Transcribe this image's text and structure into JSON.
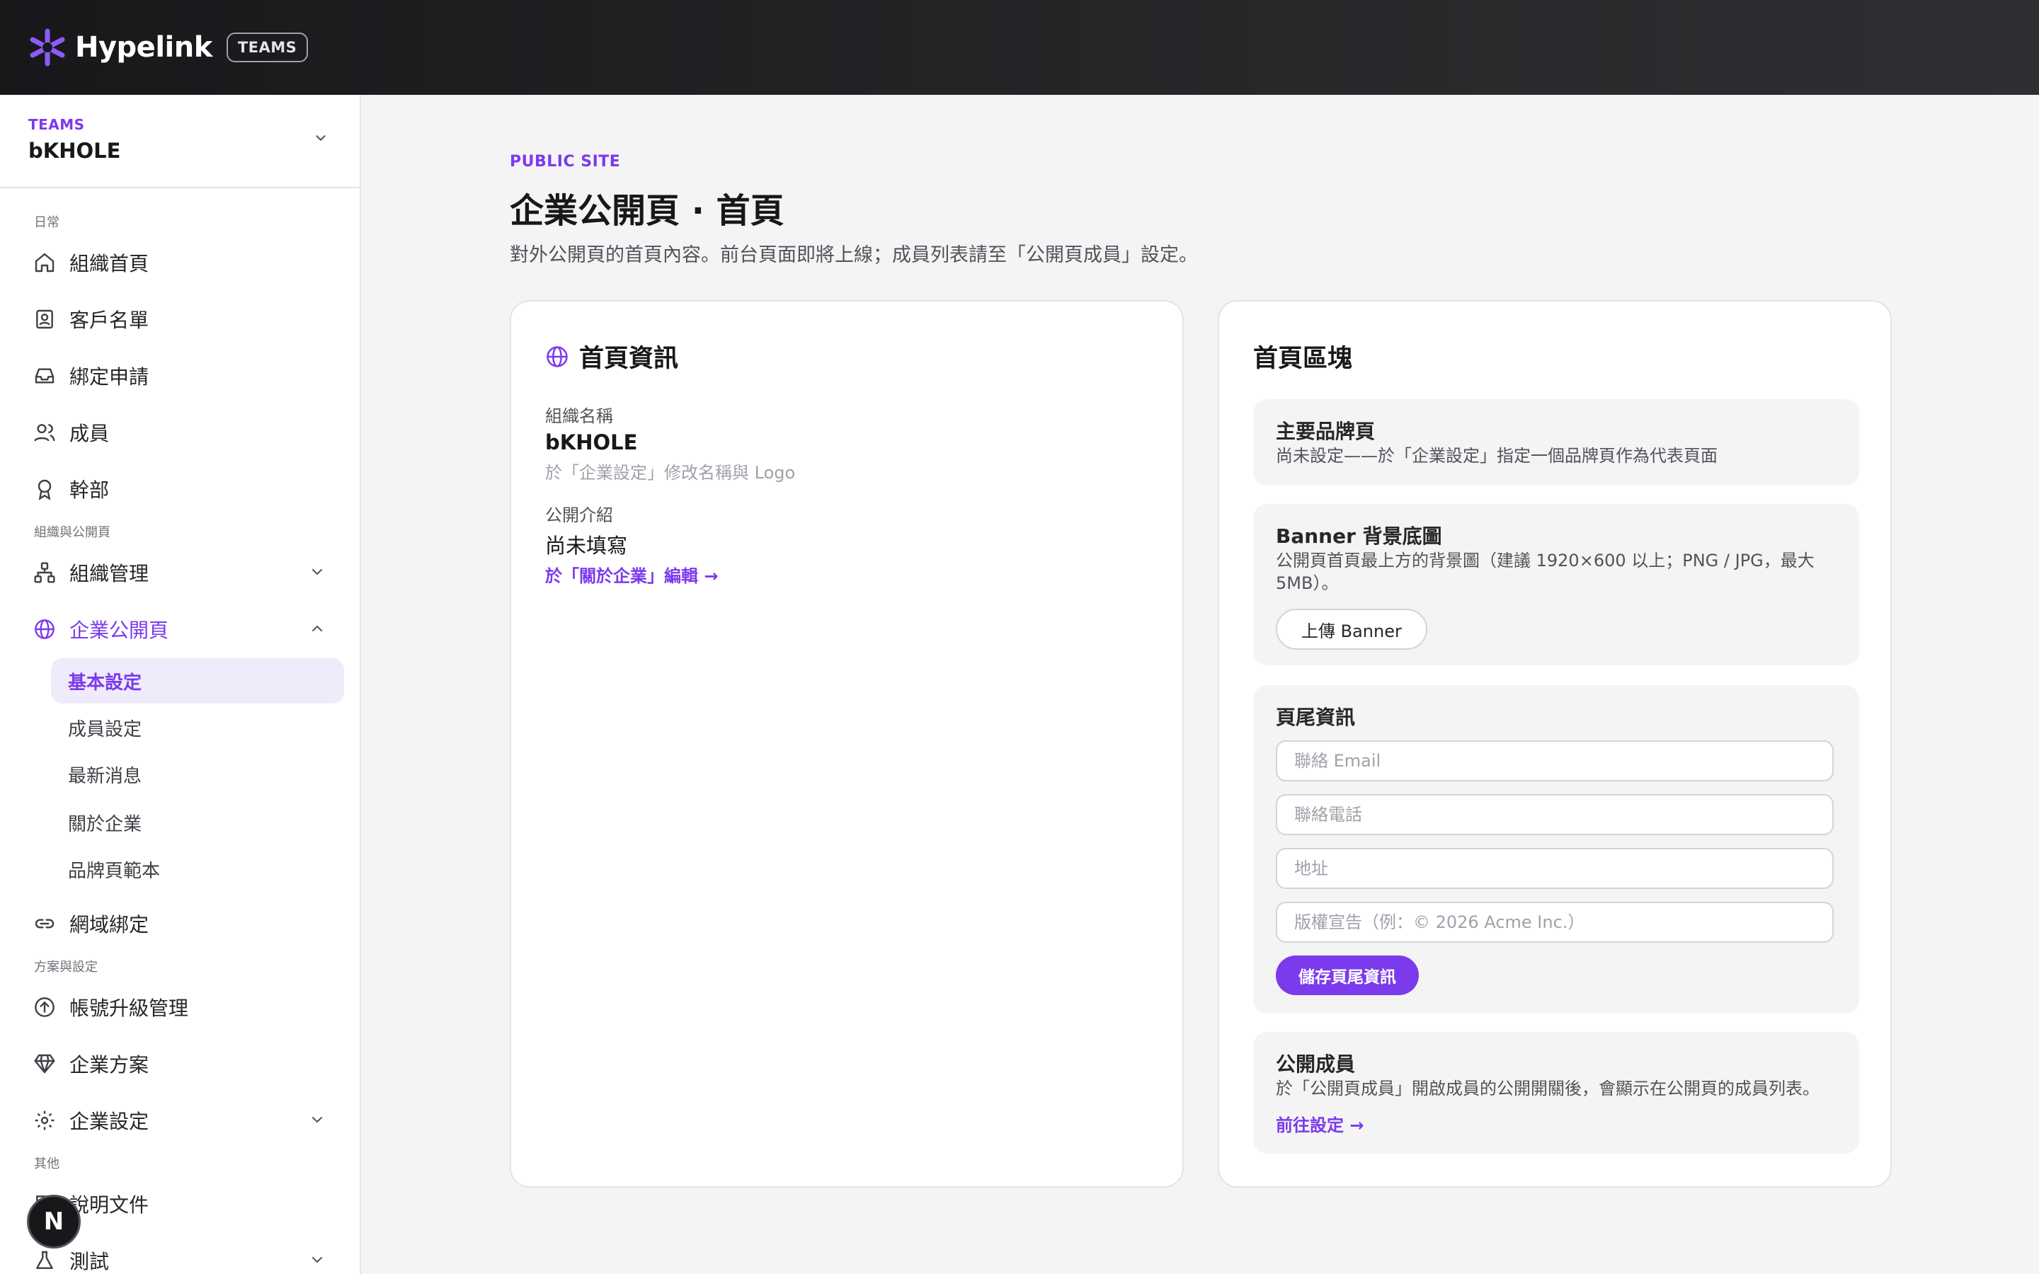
{
  "app": {
    "name": "Hypelink",
    "badge": "TEAMS"
  },
  "team": {
    "label": "TEAMS",
    "name": "bKHOLE"
  },
  "sidebar": {
    "sections": {
      "daily": "日常",
      "org": "組織與公開頁",
      "plan": "方案與設定",
      "other": "其他"
    },
    "items": {
      "org_home": "組織首頁",
      "customers": "客戶名單",
      "binding": "綁定申請",
      "members": "成員",
      "officers": "幹部",
      "org_manage": "組織管理",
      "public_page": "企業公開頁",
      "domain": "網域綁定",
      "upgrade": "帳號升級管理",
      "plan": "企業方案",
      "settings": "企業設定",
      "docs": "說明文件",
      "test": "測試"
    },
    "sub_items": {
      "basic": "基本設定",
      "member_settings": "成員設定",
      "news": "最新消息",
      "about": "關於企業",
      "brand_template": "品牌頁範本"
    },
    "avatar_initial": "N"
  },
  "header": {
    "eyebrow": "PUBLIC SITE",
    "title": "企業公開頁 · 首頁",
    "description": "對外公開頁的首頁內容。前台頁面即將上線；成員列表請至「公開頁成員」設定。"
  },
  "info_card": {
    "title": "首頁資訊",
    "org_name_label": "組織名稱",
    "org_name_value": "bKHOLE",
    "org_name_hint": "於「企業設定」修改名稱與 Logo",
    "intro_label": "公開介紹",
    "intro_value": "尚未填寫",
    "intro_link": "於「關於企業」編輯 →"
  },
  "blocks_card": {
    "title": "首頁區塊",
    "brand": {
      "title": "主要品牌頁",
      "text": "尚未設定——於「企業設定」指定一個品牌頁作為代表頁面"
    },
    "banner": {
      "title": "Banner 背景底圖",
      "text": "公開頁首頁最上方的背景圖（建議 1920×600 以上；PNG / JPG，最大 5MB）。",
      "button": "上傳 Banner"
    },
    "footer": {
      "title": "頁尾資訊",
      "email_placeholder": "聯絡 Email",
      "phone_placeholder": "聯絡電話",
      "address_placeholder": "地址",
      "copyright_placeholder": "版權宣告（例：© 2026 Acme Inc.）",
      "save_button": "儲存頁尾資訊"
    },
    "public_members": {
      "title": "公開成員",
      "text": "於「公開頁成員」開啟成員的公開開關後，會顯示在公開頁的成員列表。",
      "link": "前往設定 →"
    }
  },
  "colors": {
    "accent": "#7c3aed",
    "accent_soft": "#f0ebfb",
    "topbar": "#18181b"
  }
}
